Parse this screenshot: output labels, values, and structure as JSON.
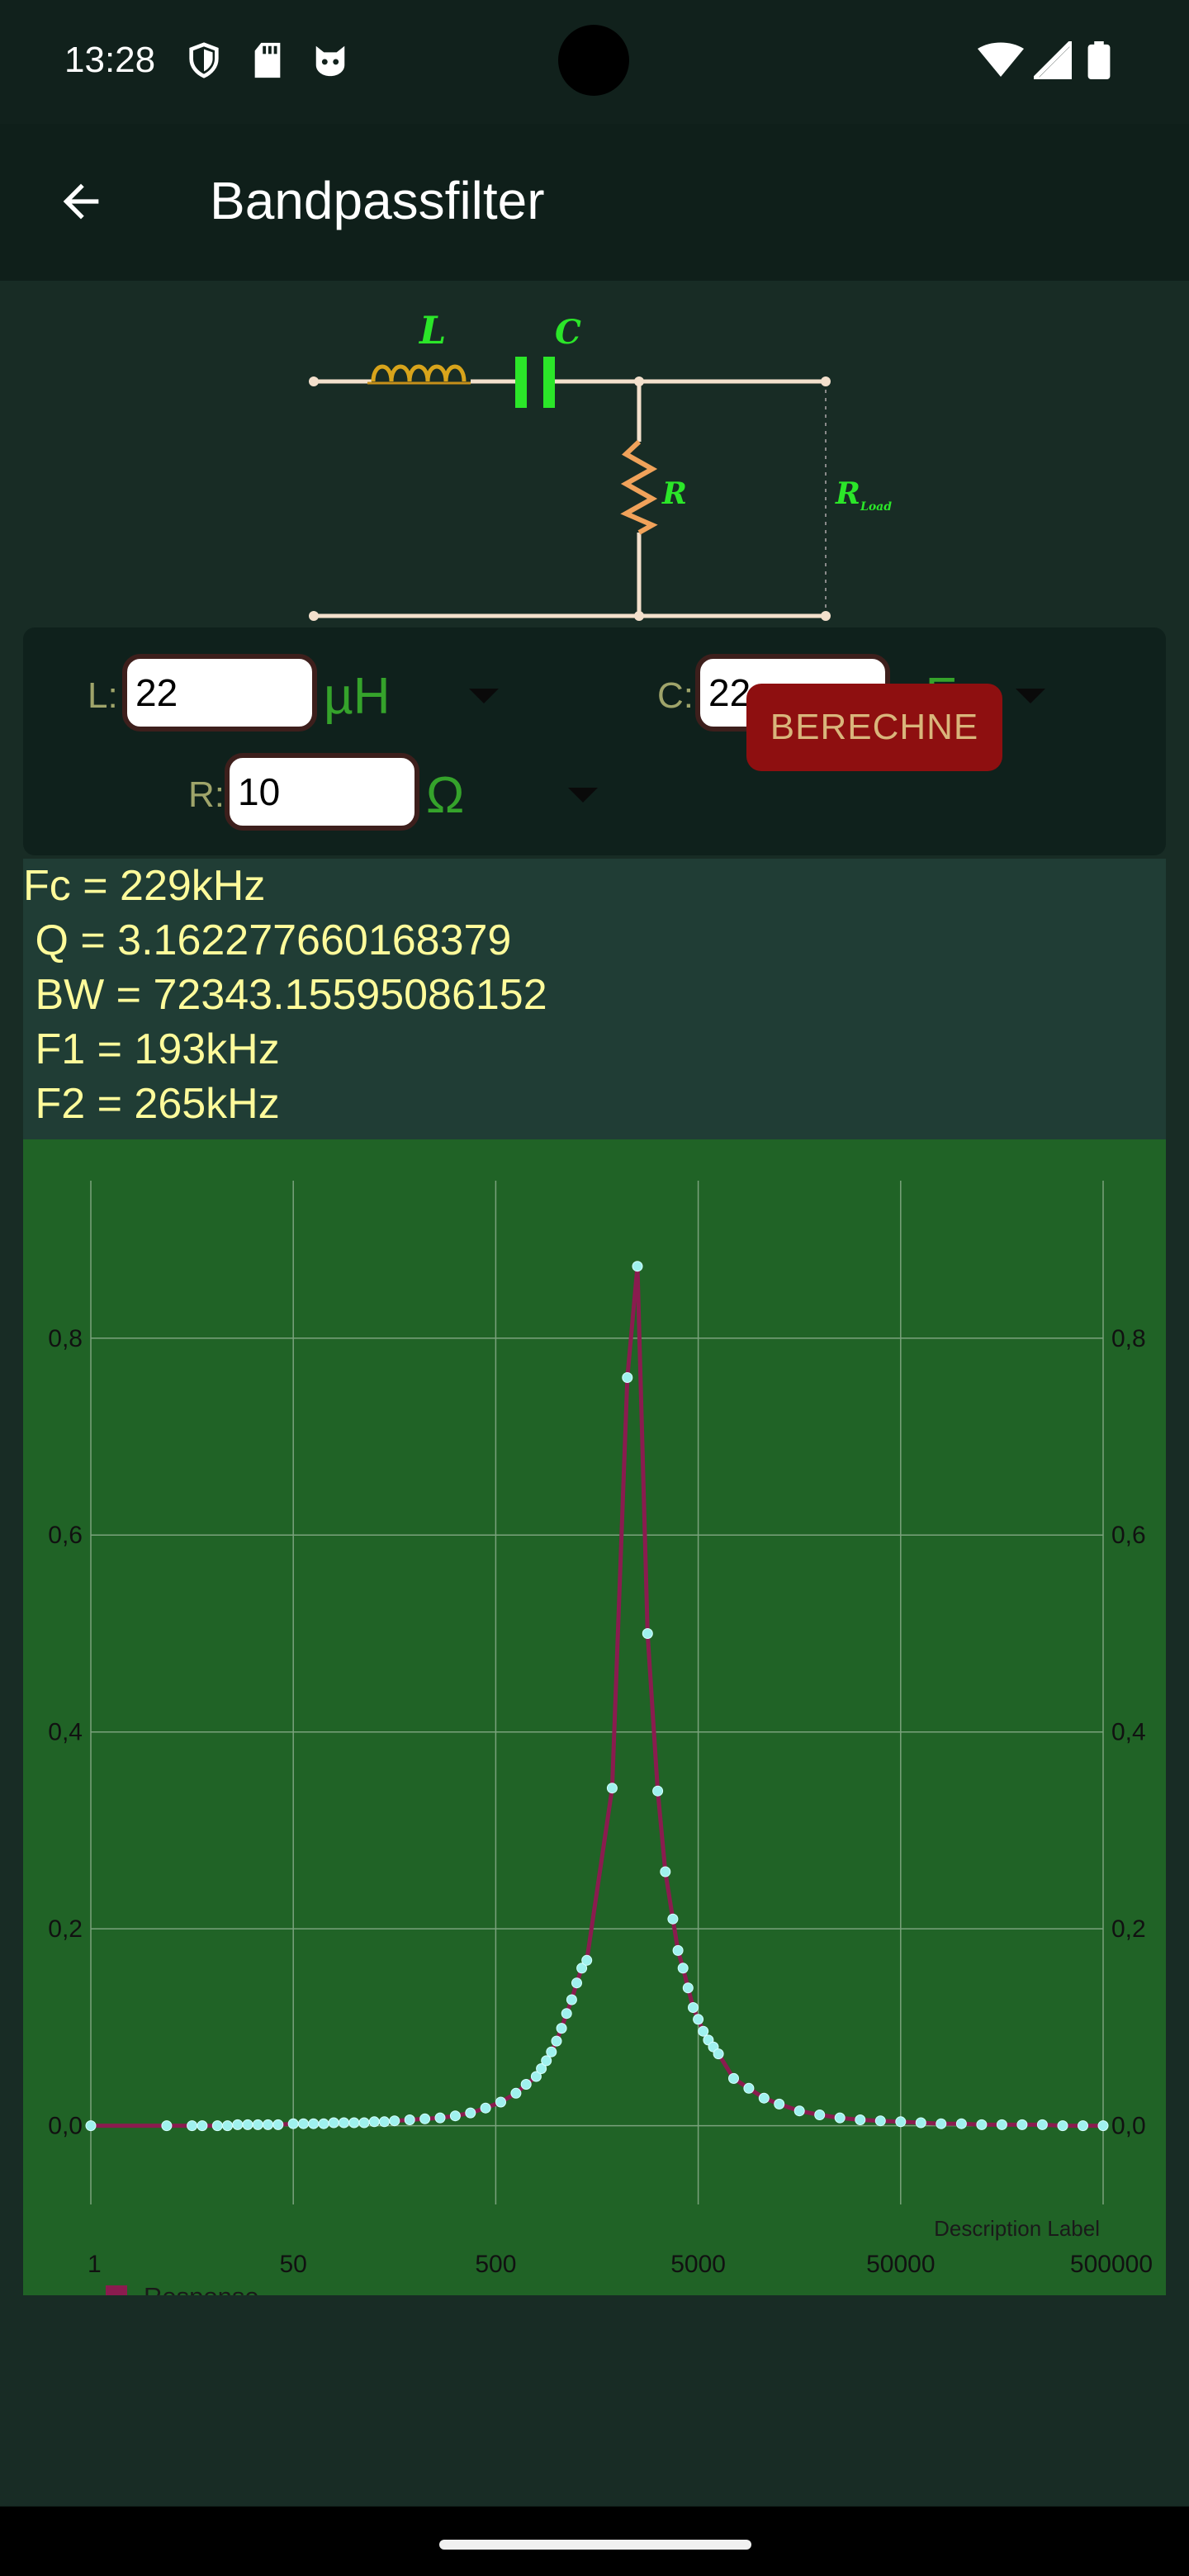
{
  "status": {
    "time": "13:28",
    "icons": [
      "shield-icon",
      "sd-card-icon",
      "cat-icon",
      "wifi-icon",
      "signal-icon",
      "battery-icon"
    ]
  },
  "app_bar": {
    "title": "Bandpassfilter",
    "back_icon": "arrow-left-icon"
  },
  "circuit": {
    "labels": {
      "L": "L",
      "C": "C",
      "R": "R",
      "R_load": "R",
      "R_load_sub": "Load"
    }
  },
  "inputs": {
    "L": {
      "label": "L:",
      "value": "22",
      "unit": "µH"
    },
    "C": {
      "label": "C:",
      "value": "22",
      "unit": "nF"
    },
    "R": {
      "label": "R:",
      "value": "10",
      "unit": "Ω"
    },
    "calc_label": "BERECHNE"
  },
  "results": {
    "line1": "Fc = 229kHz",
    "line2": " Q = 3.162277660168379",
    "line3": " BW = 72343.15595086152",
    "line4": " F1 = 193kHz",
    "line5": " F2 = 265kHz"
  },
  "colors": {
    "chart_bg": "#206326",
    "line": "#8a1c4f",
    "point": "#9ff1ee",
    "result_text": "#fffb9b",
    "unit_text": "#35a32b",
    "button_bg": "#8e0f10"
  },
  "chart_data": {
    "type": "line",
    "title": "",
    "xlabel": "",
    "ylabel": "",
    "description_label": "Description Label",
    "x_tick_labels": [
      "1",
      "50",
      "500",
      "5000",
      "50000",
      "500000"
    ],
    "y_ticks": [
      0.0,
      0.2,
      0.4,
      0.6,
      0.8
    ],
    "y_tick_labels": [
      "0,0",
      "0,2",
      "0,4",
      "0,6",
      "0,8"
    ],
    "ylim": [
      -0.08,
      0.96
    ],
    "legend": {
      "position": "bottom-left",
      "entries": [
        "Response"
      ]
    },
    "series": [
      {
        "name": "Response",
        "points": [
          [
            0,
            0.0
          ],
          [
            1.5,
            0.0
          ],
          [
            2.0,
            0.0
          ],
          [
            2.2,
            0.0
          ],
          [
            2.5,
            0.0
          ],
          [
            2.7,
            0.0
          ],
          [
            2.9,
            0.001
          ],
          [
            3.1,
            0.001
          ],
          [
            3.3,
            0.001
          ],
          [
            3.5,
            0.001
          ],
          [
            3.7,
            0.001
          ],
          [
            4.0,
            0.002
          ],
          [
            4.2,
            0.002
          ],
          [
            4.4,
            0.002
          ],
          [
            4.6,
            0.002
          ],
          [
            4.8,
            0.003
          ],
          [
            5.0,
            0.003
          ],
          [
            5.2,
            0.003
          ],
          [
            5.4,
            0.003
          ],
          [
            5.6,
            0.004
          ],
          [
            5.8,
            0.004
          ],
          [
            6.0,
            0.005
          ],
          [
            6.3,
            0.006
          ],
          [
            6.6,
            0.007
          ],
          [
            6.9,
            0.008
          ],
          [
            7.2,
            0.01
          ],
          [
            7.5,
            0.013
          ],
          [
            7.8,
            0.018
          ],
          [
            8.1,
            0.024
          ],
          [
            8.4,
            0.033
          ],
          [
            8.6,
            0.042
          ],
          [
            8.8,
            0.05
          ],
          [
            8.9,
            0.058
          ],
          [
            9.0,
            0.066
          ],
          [
            9.1,
            0.075
          ],
          [
            9.2,
            0.086
          ],
          [
            9.3,
            0.099
          ],
          [
            9.4,
            0.114
          ],
          [
            9.5,
            0.128
          ],
          [
            9.6,
            0.145
          ],
          [
            9.7,
            0.16
          ],
          [
            9.8,
            0.168
          ],
          [
            10.3,
            0.343
          ],
          [
            10.6,
            0.76
          ],
          [
            10.8,
            0.873
          ],
          [
            11.0,
            0.5
          ],
          [
            11.2,
            0.34
          ],
          [
            11.35,
            0.258
          ],
          [
            11.5,
            0.21
          ],
          [
            11.6,
            0.178
          ],
          [
            11.7,
            0.16
          ],
          [
            11.8,
            0.14
          ],
          [
            11.9,
            0.12
          ],
          [
            12.0,
            0.108
          ],
          [
            12.1,
            0.096
          ],
          [
            12.2,
            0.087
          ],
          [
            12.3,
            0.08
          ],
          [
            12.4,
            0.073
          ],
          [
            12.7,
            0.048
          ],
          [
            13.0,
            0.038
          ],
          [
            13.3,
            0.028
          ],
          [
            13.6,
            0.022
          ],
          [
            14.0,
            0.015
          ],
          [
            14.4,
            0.011
          ],
          [
            14.8,
            0.008
          ],
          [
            15.2,
            0.006
          ],
          [
            15.6,
            0.005
          ],
          [
            16.0,
            0.004
          ],
          [
            16.4,
            0.003
          ],
          [
            16.8,
            0.002
          ],
          [
            17.2,
            0.002
          ],
          [
            17.6,
            0.001
          ],
          [
            18.0,
            0.001
          ],
          [
            18.4,
            0.001
          ],
          [
            18.8,
            0.001
          ],
          [
            19.2,
            0.0
          ],
          [
            19.6,
            0.0
          ],
          [
            20.0,
            0.0
          ]
        ]
      }
    ]
  }
}
